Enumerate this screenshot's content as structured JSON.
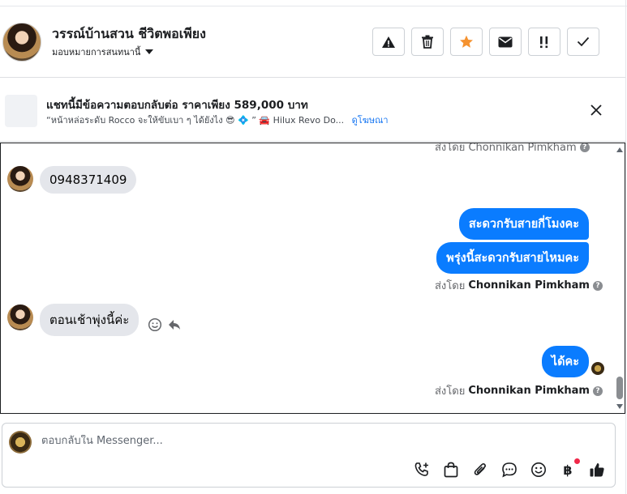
{
  "contact": {
    "name": "วรรณ์บ้านสวน ชีวิตพอเพียง",
    "assign_label": "มอบหมายการสนทนานี้"
  },
  "header_actions": [
    {
      "id": "report",
      "icon": "warning-icon"
    },
    {
      "id": "delete",
      "icon": "trash-icon"
    },
    {
      "id": "star",
      "icon": "star-icon",
      "color": "#f5922f"
    },
    {
      "id": "mark-unread",
      "icon": "envelope-icon"
    },
    {
      "id": "follow-up",
      "icon": "double-exclamation-icon"
    },
    {
      "id": "done",
      "icon": "check-icon"
    }
  ],
  "ad": {
    "title": "แชทนี้มีข้อความตอบกลับต่อ ราคาเพียง 589,000 บาท",
    "snippet": "“หน้าหล่อระดับ Rocco จะให้ขับเบา ๆ ได้ยังไง 😎 💠 ” 🚘 Hilux Revo Do...",
    "link": "ดูโฆษณา"
  },
  "thread": {
    "top_partial_sender": "ส่งโดย Chonnikan Pimkham",
    "messages": [
      {
        "direction": "in",
        "text": "0948371409"
      },
      {
        "direction": "out",
        "text": "สะดวกรับสายกี่โมงคะ"
      },
      {
        "direction": "out",
        "text": "พรุ่งนี้สะดวกรับสายไหมคะ"
      },
      {
        "direction": "in",
        "text": "ตอนเช้าพุ่งนี้ค่ะ"
      },
      {
        "direction": "out",
        "text": "ได้คะ"
      }
    ],
    "sent_by_prefix": "ส่งโดย",
    "sent_by_name": "Chonnikan Pimkham"
  },
  "composer": {
    "placeholder": "ตอบกลับใน Messenger...",
    "tools": [
      "phone-plus-icon",
      "shopping-bag-icon",
      "paperclip-icon",
      "chat-bubble-icon",
      "smiley-icon",
      "baht-icon",
      "thumbs-up-icon"
    ],
    "baht_symbol": "฿"
  },
  "colors": {
    "accent": "#0a7cff",
    "link": "#1877f2",
    "incoming_bubble": "#e4e6eb",
    "star": "#f5922f",
    "notification_dot": "#f02849"
  }
}
